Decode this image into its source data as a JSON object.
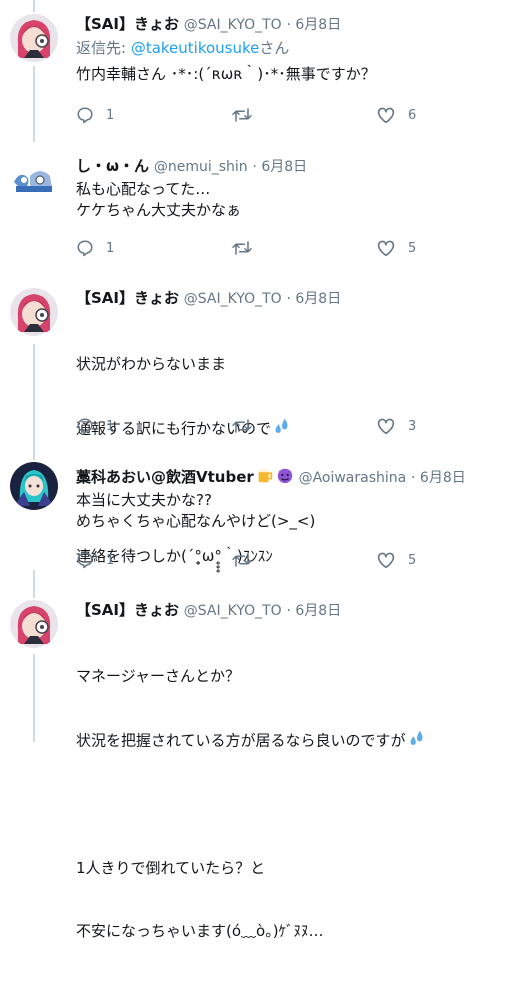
{
  "tweets": [
    {
      "name": "【SAI】きょお",
      "handle": "@SAI_KYO_TO",
      "date": "· 6月8日",
      "reply_prefix": "返信先: ",
      "reply_handle": "@takeutikousuke",
      "reply_suffix": "さん",
      "text": "竹内幸輔さん ･*･:(´ʀωʀ｀)･*･無事ですか？",
      "replies": "1",
      "likes": "6"
    },
    {
      "name": "し・ω・ん",
      "handle": "@nemui_shin",
      "date": "· 6月8日",
      "text": "私も心配なってた…\nケケちゃん大丈夫かなぁ",
      "replies": "1",
      "likes": "5"
    },
    {
      "name": "【SAI】きょお",
      "handle": "@SAI_KYO_TO",
      "date": "· 6月8日",
      "text_line1": "状況がわからないまま",
      "text_line2": "通報する訳にも行かないので",
      "text_line3": "連絡を待つしか(´°̥̥̥ω°̥̥̥｀)ｽﾝｽﾝ",
      "replies": "1",
      "likes": "3"
    },
    {
      "name": "藁科あおい@飲酒Vtuber",
      "handle": "@Aoiwarashina",
      "date": "· 6月8日",
      "text": "本当に大丈夫かな??\nめちゃくちゃ心配なんやけど(>_<)",
      "replies": "1",
      "likes": "5"
    },
    {
      "name": "【SAI】きょお",
      "handle": "@SAI_KYO_TO",
      "date": "· 6月8日",
      "text_line1": "マネージャーさんとか？",
      "text_line2": "状況を把握されている方が居るなら良いのですが",
      "text_line3": "1人きりで倒れていたら？と",
      "text_line4": "不安になっちゃいます(ó﹏ò。)ｹﾞﾇﾇ…"
    }
  ],
  "colors": {
    "accent": "#1da1f2",
    "muted": "#657786",
    "line": "#cfd9de"
  },
  "icons": [
    "reply-icon",
    "retweet-icon",
    "like-icon",
    "sweat-drops-icon",
    "beer-icon",
    "devil-icon"
  ]
}
